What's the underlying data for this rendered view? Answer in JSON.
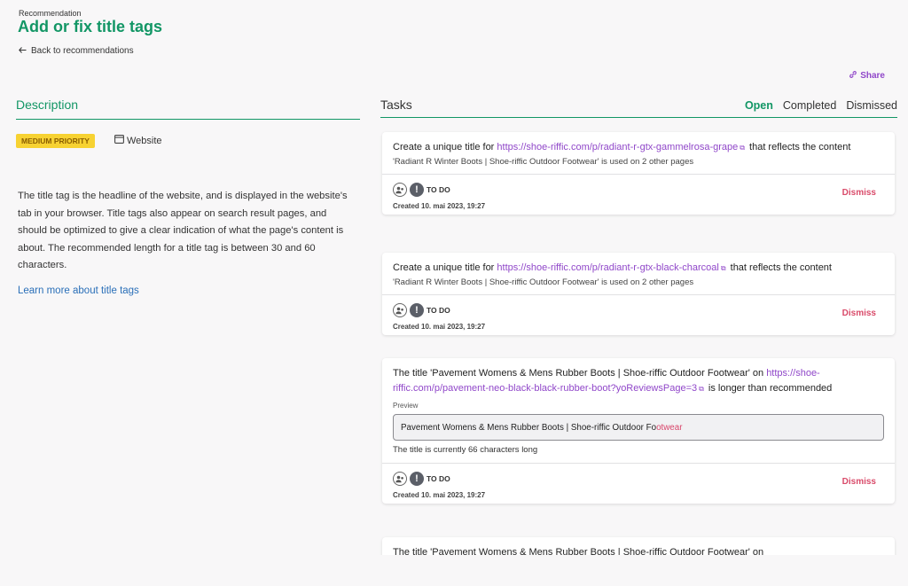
{
  "header": {
    "eyebrow": "Recommendation",
    "title": "Add or fix title tags",
    "back_label": "Back to recommendations",
    "share_label": "Share"
  },
  "description": {
    "heading": "Description",
    "priority": "MEDIUM PRIORITY",
    "scope": "Website",
    "text": "The title tag is the headline of the website, and is displayed in the website's tab in your browser. Title tags also appear on search result pages, and should be optimized to give a clear indication of what the page's content is about. The recommended length for a title tag is between 30 and 60 characters.",
    "learn_more": "Learn more about title tags"
  },
  "tasks": {
    "heading": "Tasks",
    "tabs": [
      "Open",
      "Completed",
      "Dismissed"
    ],
    "active_tab": "Open",
    "items": [
      {
        "pre": "Create a unique title for ",
        "url": "https://shoe-riffic.com/p/radiant-r-gtx-gammelrosa-grape",
        "post": " that reflects the content",
        "sub": "'Radiant R Winter Boots | Shoe-riffic Outdoor Footwear' is used on 2 other pages",
        "status": "TO DO",
        "created": "Created 10. mai 2023, 19:27",
        "dismiss": "Dismiss"
      },
      {
        "pre": "Create a unique title for ",
        "url": "https://shoe-riffic.com/p/radiant-r-gtx-black-charcoal",
        "post": " that reflects the content",
        "sub": "'Radiant R Winter Boots | Shoe-riffic Outdoor Footwear' is used on 2 other pages",
        "status": "TO DO",
        "created": "Created 10. mai 2023, 19:27",
        "dismiss": "Dismiss"
      },
      {
        "pre": "The title 'Pavement Womens & Mens Rubber Boots | Shoe-riffic Outdoor Footwear' on ",
        "url": "https://shoe-riffic.com/p/pavement-neo-black-black-rubber-boot?yoReviewsPage=3",
        "post": " is longer than recommended",
        "preview_label": "Preview",
        "preview_ok": "Pavement Womens & Mens Rubber Boots | Shoe-riffic Outdoor Fo",
        "preview_over": "otwear",
        "char_note": "The title is currently 66 characters long",
        "status": "TO DO",
        "created": "Created 10. mai 2023, 19:27",
        "dismiss": "Dismiss"
      },
      {
        "pre": "The title 'Pavement Womens & Mens Rubber Boots | Shoe-riffic Outdoor Footwear' on"
      }
    ]
  },
  "colors": {
    "accent": "#129665",
    "link": "#9047c9",
    "dismiss": "#d94b6a",
    "priority_bg": "#f7d232"
  },
  "icons": [
    "arrow-left-icon",
    "link-icon",
    "browser-window-icon",
    "external-link-icon",
    "user-assign-icon",
    "exclamation-icon"
  ]
}
